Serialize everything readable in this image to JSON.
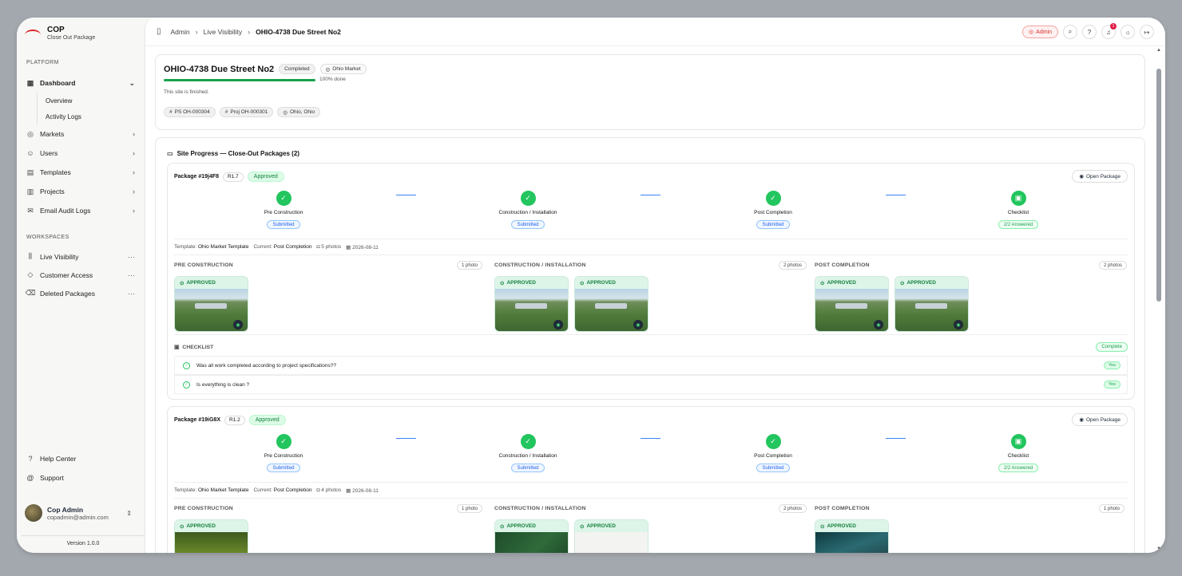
{
  "app": {
    "title": "COP",
    "subtitle": "Close Out Package"
  },
  "sidebar": {
    "platform_label": "PLATFORM",
    "items": [
      {
        "label": "Dashboard",
        "icon": "dashboard-icon"
      },
      {
        "label": "Markets",
        "icon": "pin-icon"
      },
      {
        "label": "Users",
        "icon": "users-icon"
      },
      {
        "label": "Templates",
        "icon": "file-icon"
      },
      {
        "label": "Projects",
        "icon": "building-icon"
      },
      {
        "label": "Email Audit Logs",
        "icon": "mail-icon"
      }
    ],
    "dashboard_sub": [
      "Overview",
      "Activity Logs"
    ],
    "workspaces_label": "WORKSPACES",
    "workspaces": [
      {
        "label": "Live Visibility",
        "icon": "chart-icon"
      },
      {
        "label": "Customer Access",
        "icon": "shield-icon"
      },
      {
        "label": "Deleted Packages",
        "icon": "trash-icon"
      }
    ],
    "help": "Help Center",
    "support": "Support",
    "user": {
      "name": "Cop Admin",
      "email": "copadmin@admin.com"
    },
    "version": "Version 1.0.0"
  },
  "breadcrumb": {
    "items": [
      "Admin",
      "Live Visibility"
    ],
    "current": "OHIO-4738 Due Street No2"
  },
  "topbar": {
    "admin_badge": "Admin",
    "notif_count": "1"
  },
  "site": {
    "title": "OHIO-4738 Due Street No2",
    "status": "Completed",
    "market": "Ohio Market",
    "progress_pct": 100,
    "progress_label": "100% done",
    "note": "This site is finished.",
    "tags": [
      "PS OH-000304",
      "Proj OH-000301",
      "Ohio, Ohio"
    ]
  },
  "progress_section": {
    "title": "Site Progress — Close-Out Packages (2)"
  },
  "packages": [
    {
      "id": "Package #19j4F8",
      "rev": "R1.7",
      "status": "Approved",
      "open": "Open Package",
      "steps": [
        {
          "label": "Pre Construction",
          "badge": "Submitted"
        },
        {
          "label": "Construction / Installation",
          "badge": "Submitted"
        },
        {
          "label": "Post Completion",
          "badge": "Submitted"
        },
        {
          "label": "Checklist",
          "badge": "2/2 Answered"
        }
      ],
      "meta": {
        "template_label": "Template:",
        "template": "Ohio Market Template",
        "current_label": "Current:",
        "current": "Post Completion",
        "photos": "5 photos",
        "date": "2026-08-11"
      },
      "columns": [
        {
          "title": "PRE CONSTRUCTION",
          "count": "1 photo"
        },
        {
          "title": "CONSTRUCTION / INSTALLATION",
          "count": "2 photos"
        },
        {
          "title": "POST COMPLETION",
          "count": "2 photos"
        }
      ],
      "photo_label": "APPROVED",
      "checklist": {
        "title": "CHECKLIST",
        "status": "Complete",
        "items": [
          {
            "q": "Was all work completed according to project specifications??",
            "a": "Yes"
          },
          {
            "q": "Is everything is clean ?",
            "a": "Yes"
          }
        ]
      }
    },
    {
      "id": "Package #19iG8X",
      "rev": "R1.2",
      "status": "Approved",
      "open": "Open Package",
      "steps": [
        {
          "label": "Pre Construction",
          "badge": "Submitted"
        },
        {
          "label": "Construction / Installation",
          "badge": "Submitted"
        },
        {
          "label": "Post Completion",
          "badge": "Submitted"
        },
        {
          "label": "Checklist",
          "badge": "2/2 Answered"
        }
      ],
      "meta": {
        "template_label": "Template:",
        "template": "Ohio Market Template",
        "current_label": "Current:",
        "current": "Post Completion",
        "photos": "4 photos",
        "date": "2026-08-11"
      },
      "columns": [
        {
          "title": "PRE CONSTRUCTION",
          "count": "1 photo"
        },
        {
          "title": "CONSTRUCTION / INSTALLATION",
          "count": "2 photos"
        },
        {
          "title": "POST COMPLETION",
          "count": "1 photo"
        }
      ],
      "photo_label": "APPROVED"
    }
  ]
}
